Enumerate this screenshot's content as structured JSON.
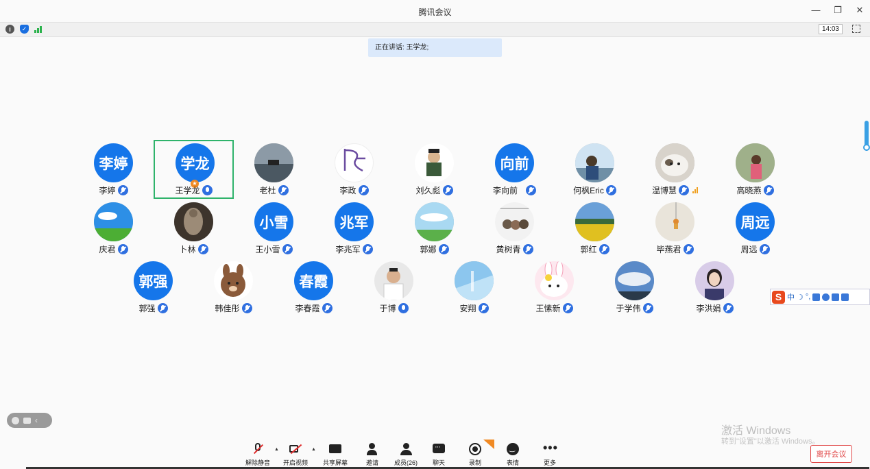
{
  "window": {
    "title": "腾讯会议",
    "time": "14:03"
  },
  "speaking": {
    "text": "正在讲话: 王学龙;"
  },
  "participants": [
    {
      "name": "李婷",
      "avatar_text": "李婷"
    },
    {
      "name": "王学龙",
      "avatar_text": "学龙"
    },
    {
      "name": "老杜"
    },
    {
      "name": "李政"
    },
    {
      "name": "刘久彪"
    },
    {
      "name": "李向前",
      "avatar_text": "向前"
    },
    {
      "name": "何枫Eric"
    },
    {
      "name": "温博慧"
    },
    {
      "name": "高晓燕"
    },
    {
      "name": "庆君"
    },
    {
      "name": "卜林"
    },
    {
      "name": "王小雪",
      "avatar_text": "小雪"
    },
    {
      "name": "李兆军",
      "avatar_text": "兆军"
    },
    {
      "name": "郭娜"
    },
    {
      "name": "黄树青"
    },
    {
      "name": "郭红"
    },
    {
      "name": "毕燕君"
    },
    {
      "name": "周远",
      "avatar_text": "周远"
    },
    {
      "name": "郭强",
      "avatar_text": "郭强"
    },
    {
      "name": "韩佳彤"
    },
    {
      "name": "李春霞",
      "avatar_text": "春霞"
    },
    {
      "name": "于博"
    },
    {
      "name": "安翔"
    },
    {
      "name": "王愫新"
    },
    {
      "name": "于学伟"
    },
    {
      "name": "李洪娟"
    }
  ],
  "ime": {
    "logo": "S",
    "mode": "中"
  },
  "watermark": {
    "line1": "激活 Windows",
    "line2": "转到\"设置\"以激活 Windows。"
  },
  "toolbar": {
    "unmute": "解除静音",
    "start_video": "开启视频",
    "share_screen": "共享屏幕",
    "invite": "邀请",
    "members": "成员(26)",
    "chat": "聊天",
    "record": "录制",
    "reactions": "表情",
    "more": "更多",
    "more_glyph": "•••",
    "leave": "离开会议"
  },
  "colors": {
    "accent": "#1576ea",
    "active_border": "#2fb36b",
    "leave": "#e04545",
    "speaking_bg": "#dbe9fb"
  }
}
